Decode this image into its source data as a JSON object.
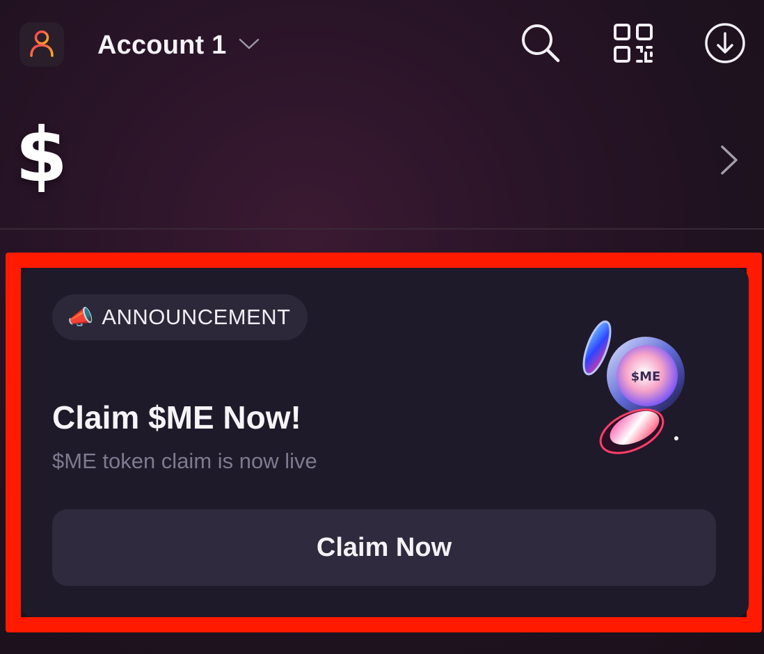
{
  "header": {
    "account_label": "Account 1",
    "icons": [
      "user-icon",
      "chevron-down-icon",
      "search-icon",
      "qr-code-icon",
      "download-icon"
    ]
  },
  "balance": {
    "value": "$"
  },
  "announcement": {
    "badge_emoji": "📣",
    "badge_label": "ANNOUNCEMENT",
    "title": "Claim $ME Now!",
    "subtitle": "$ME token claim is now live",
    "button_label": "Claim Now",
    "coin_text": "$ME"
  },
  "colors": {
    "highlight": "#ff1a00",
    "card_bg": "#1e1a2a",
    "button_bg": "#2f2a3d",
    "avatar_icon_start": "#ff4a3d",
    "avatar_icon_end": "#ffb020"
  }
}
